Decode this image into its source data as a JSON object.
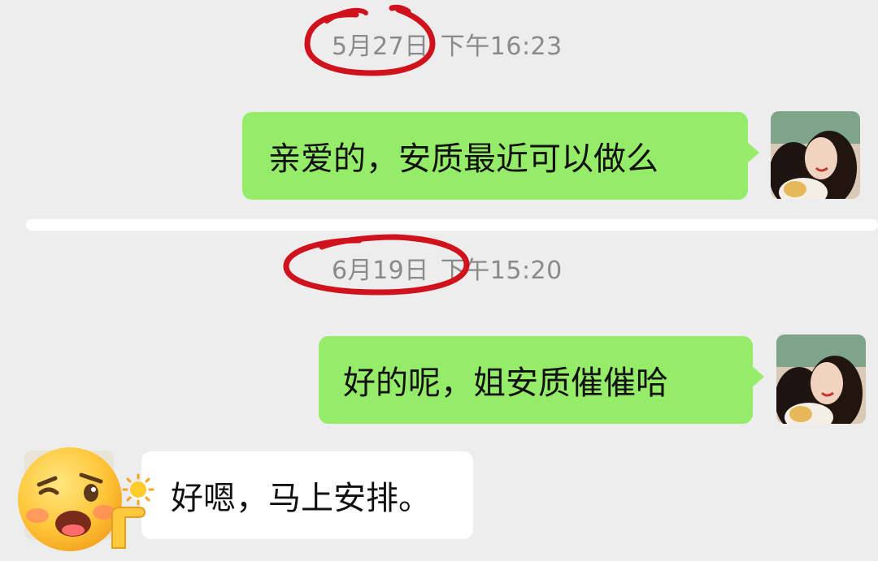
{
  "messages": [
    {
      "timestamp_date": "5月27日",
      "timestamp_time": "下午16:23",
      "direction": "outgoing",
      "text": "亲爱的，安质最近可以做么"
    },
    {
      "timestamp_date": "6月19日",
      "timestamp_time": "下午15:20",
      "direction": "outgoing",
      "text": "好的呢，姐安质催催哈"
    },
    {
      "direction": "incoming",
      "text": "好嗯，马上安排。"
    }
  ],
  "colors": {
    "background": "#ededed",
    "outgoing_bubble": "#95ec69",
    "incoming_bubble": "#ffffff",
    "timestamp_text": "#8a8a8a",
    "annotation_circle": "#d0121c"
  },
  "icons": {
    "sticker": "winking-face-with-sun-and-pointing-hand"
  }
}
